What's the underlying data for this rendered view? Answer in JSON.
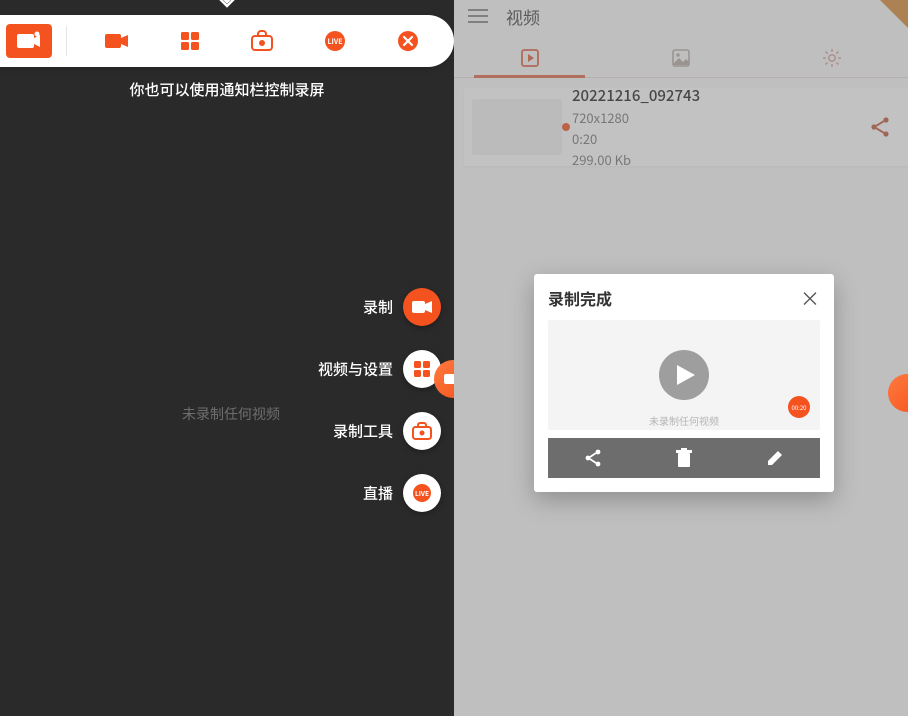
{
  "left": {
    "hint": "你也可以使用通知栏控制录屏",
    "empty": "未录制任何视频",
    "fab": {
      "record": "录制",
      "settings": "视频与设置",
      "tools": "录制工具",
      "live": "直播"
    },
    "icons": {
      "app": "screen-recorder",
      "record": "video-camera",
      "grid": "apps-grid",
      "toolbox": "camera-bag",
      "live": "live-badge",
      "close": "close"
    }
  },
  "right": {
    "title": "视频",
    "tabs": {
      "video": "video",
      "image": "image",
      "settings": "settings"
    },
    "video": {
      "name": "20221216_092743",
      "resolution": "720x1280",
      "duration": "0:20",
      "size": "299.00 Kb"
    },
    "dialog": {
      "title": "录制完成",
      "preview_sub": "未录制任何视频",
      "rec_time": "00:20",
      "actions": {
        "share": "share",
        "delete": "delete",
        "edit": "edit"
      },
      "close": "×"
    }
  },
  "colors": {
    "accent": "#f4531f",
    "dark": "#2a2a2a"
  }
}
